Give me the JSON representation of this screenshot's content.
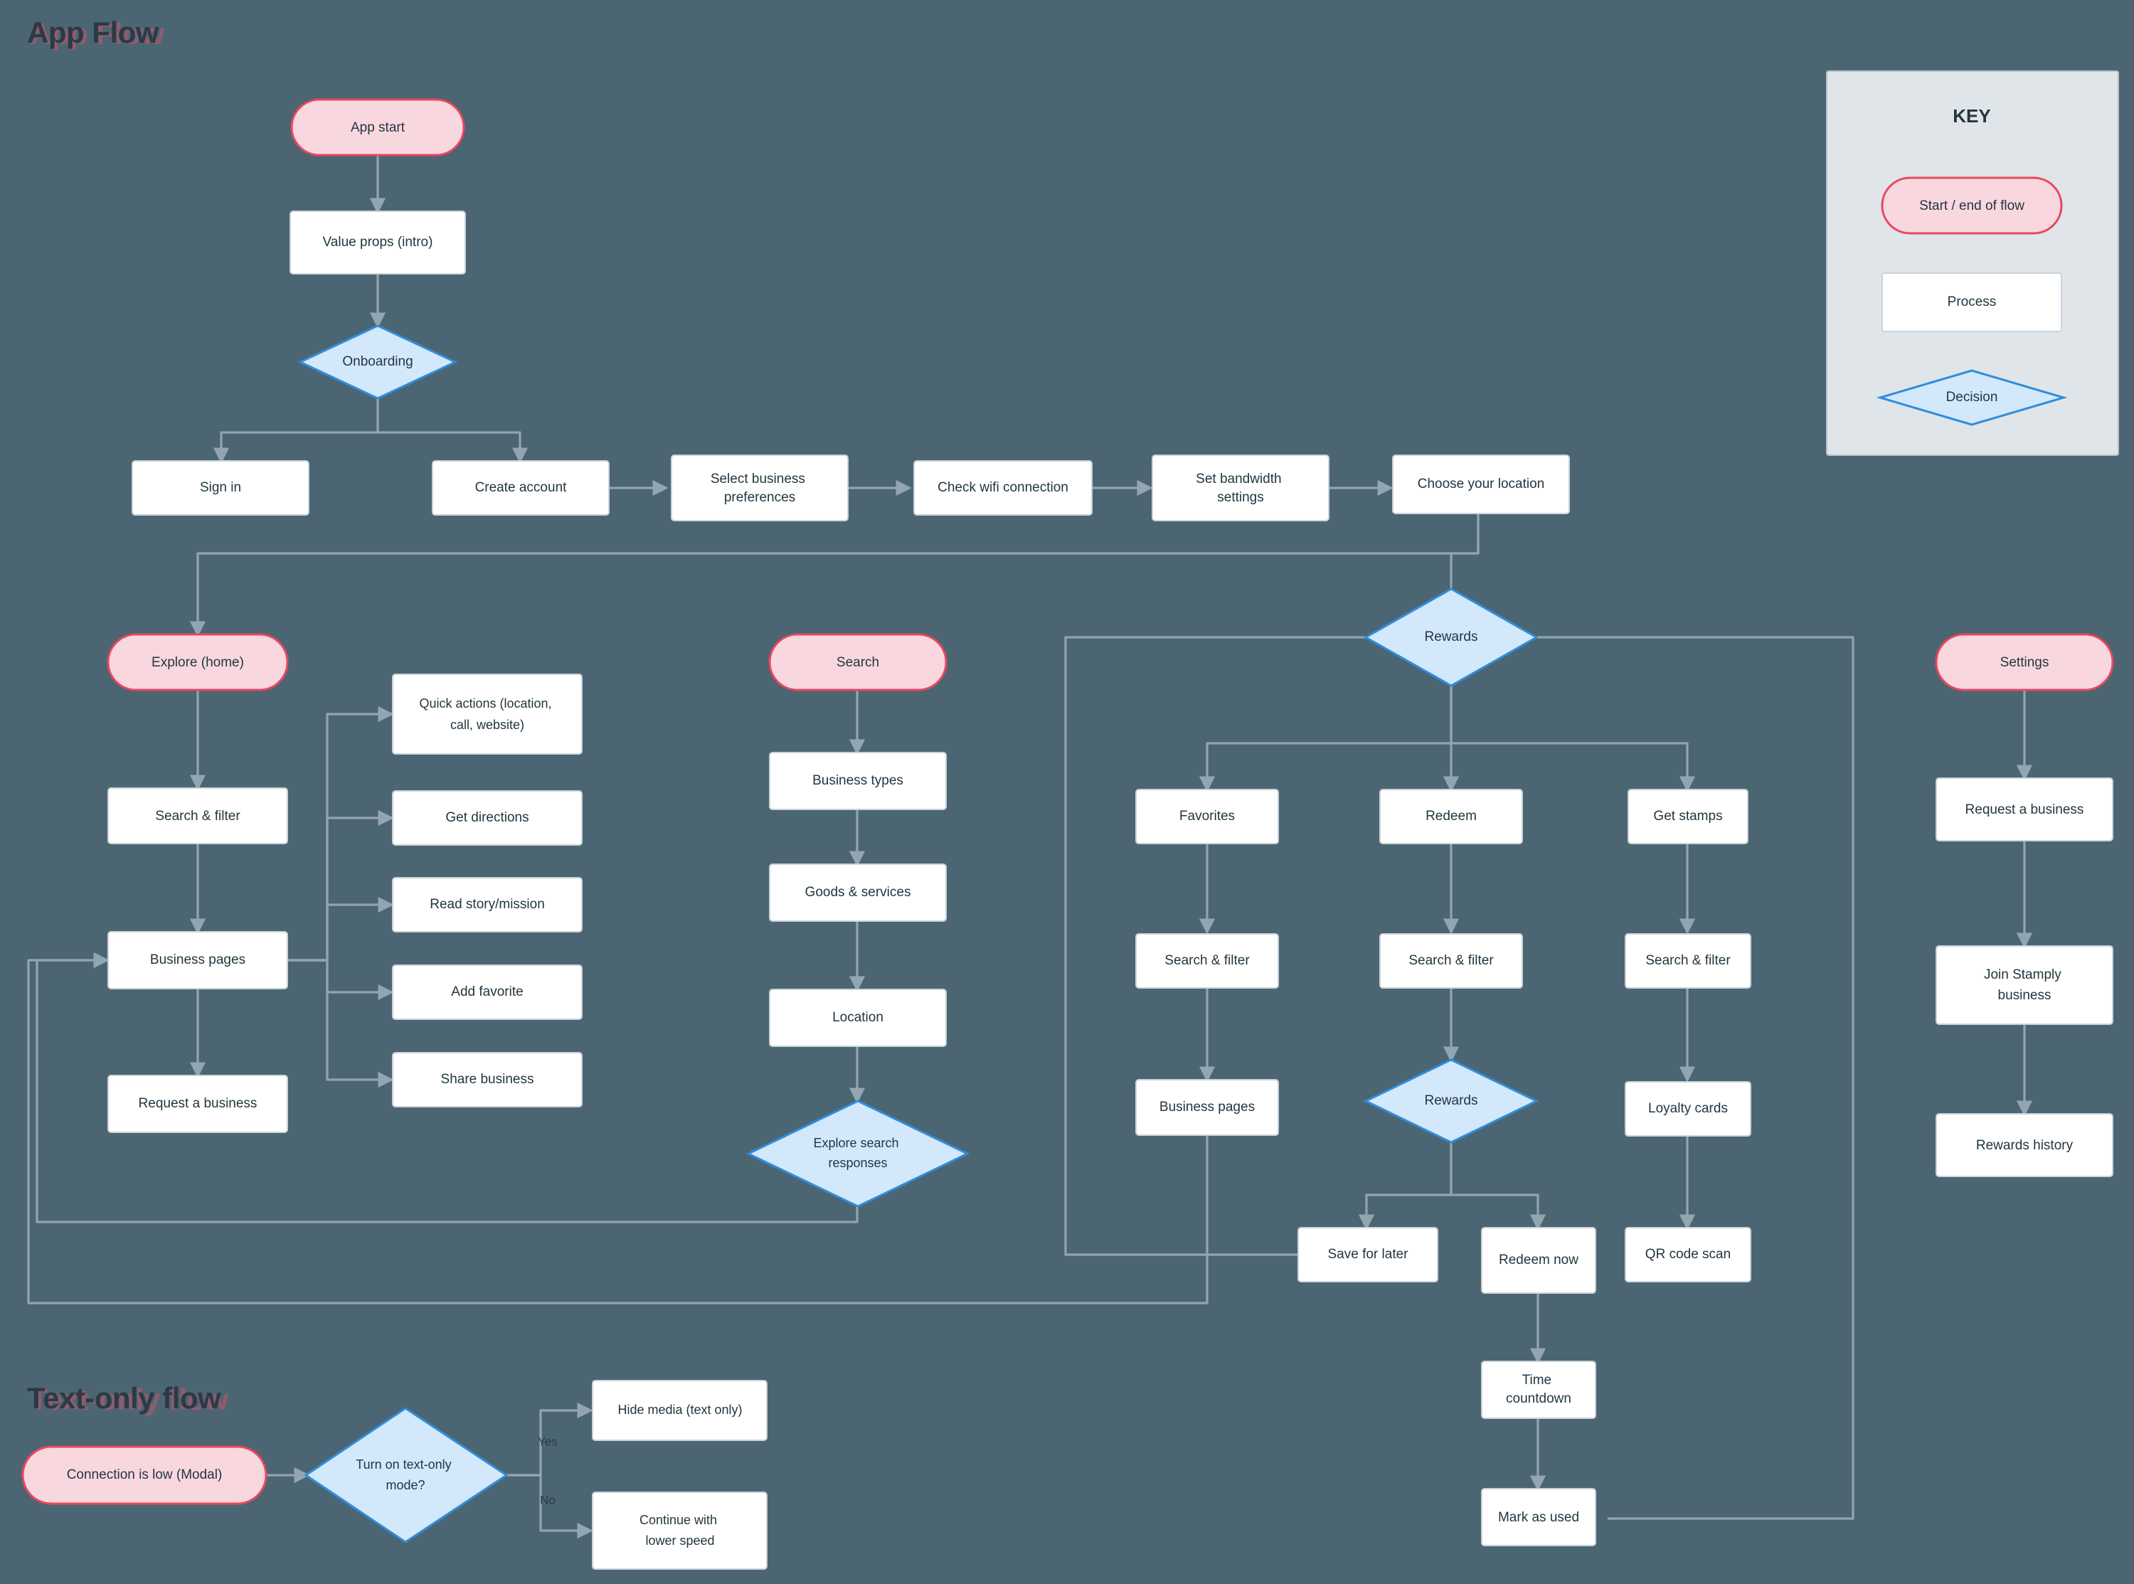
{
  "page": {
    "background_color": "#4c6572",
    "titles": {
      "app_flow": "App Flow",
      "text_only_flow": "Text-only flow"
    }
  },
  "key": {
    "title": "KEY",
    "items": [
      {
        "label": "Start / end of flow",
        "shape": "terminator",
        "fill": "#f9d7de",
        "stroke": "#e8475f"
      },
      {
        "label": "Process",
        "shape": "rect",
        "fill": "#ffffff",
        "stroke": "#c9d3da"
      },
      {
        "label": "Decision",
        "shape": "diamond",
        "fill": "#d3e8fb",
        "stroke": "#2f8ddb"
      }
    ]
  },
  "nodes": {
    "app_start": "App start",
    "value_props": "Value props (intro)",
    "onboarding": "Onboarding",
    "sign_in": "Sign in",
    "create_account": "Create account",
    "select_business_preferences": "Select business preferences",
    "check_wifi": "Check wifi connection",
    "set_bandwidth": "Set bandwidth settings",
    "choose_location": "Choose your location",
    "explore_home": "Explore (home)",
    "explore_search_filter": "Search & filter",
    "explore_business_pages": "Business pages",
    "explore_request_business": "Request a business",
    "quick_actions": "Quick actions (location, call, website)",
    "get_directions": "Get directions",
    "read_story": "Read story/mission",
    "add_favorite": "Add favorite",
    "share_business": "Share business",
    "search": "Search",
    "business_types": "Business types",
    "goods_services": "Goods & services",
    "location": "Location",
    "explore_search_responses": "Explore search responses",
    "rewards": "Rewards",
    "favorites": "Favorites",
    "fav_search_filter": "Search & filter",
    "fav_business_pages": "Business pages",
    "redeem": "Redeem",
    "redeem_search_filter": "Search & filter",
    "rewards2": "Rewards",
    "save_for_later": "Save for later",
    "redeem_now": "Redeem now",
    "time_countdown": "Time countdown",
    "mark_as_used": "Mark as used",
    "get_stamps": "Get stamps",
    "stamps_search_filter": "Search & filter",
    "loyalty_cards": "Loyalty cards",
    "qr_code_scan": "QR code scan",
    "settings": "Settings",
    "settings_request_business": "Request a business",
    "join_stamply": "Join Stamply business",
    "rewards_history": "Rewards history",
    "connection_low": "Connection is low (Modal)",
    "turn_on_text_only": "Turn on text-only mode?",
    "hide_media": "Hide media (text only)",
    "continue_lower_speed": "Continue with lower speed"
  },
  "edge_labels": {
    "yes": "Yes",
    "no": "No"
  },
  "colors": {
    "edge": "#93a5b0",
    "text": "#233640",
    "terminator_fill": "#f9d7de",
    "terminator_stroke": "#e8475f",
    "decision_fill": "#d3e8fb",
    "decision_stroke": "#2f8ddb",
    "process_fill": "#ffffff",
    "process_stroke": "#c9d3da",
    "key_panel": "#dfe5e9"
  }
}
